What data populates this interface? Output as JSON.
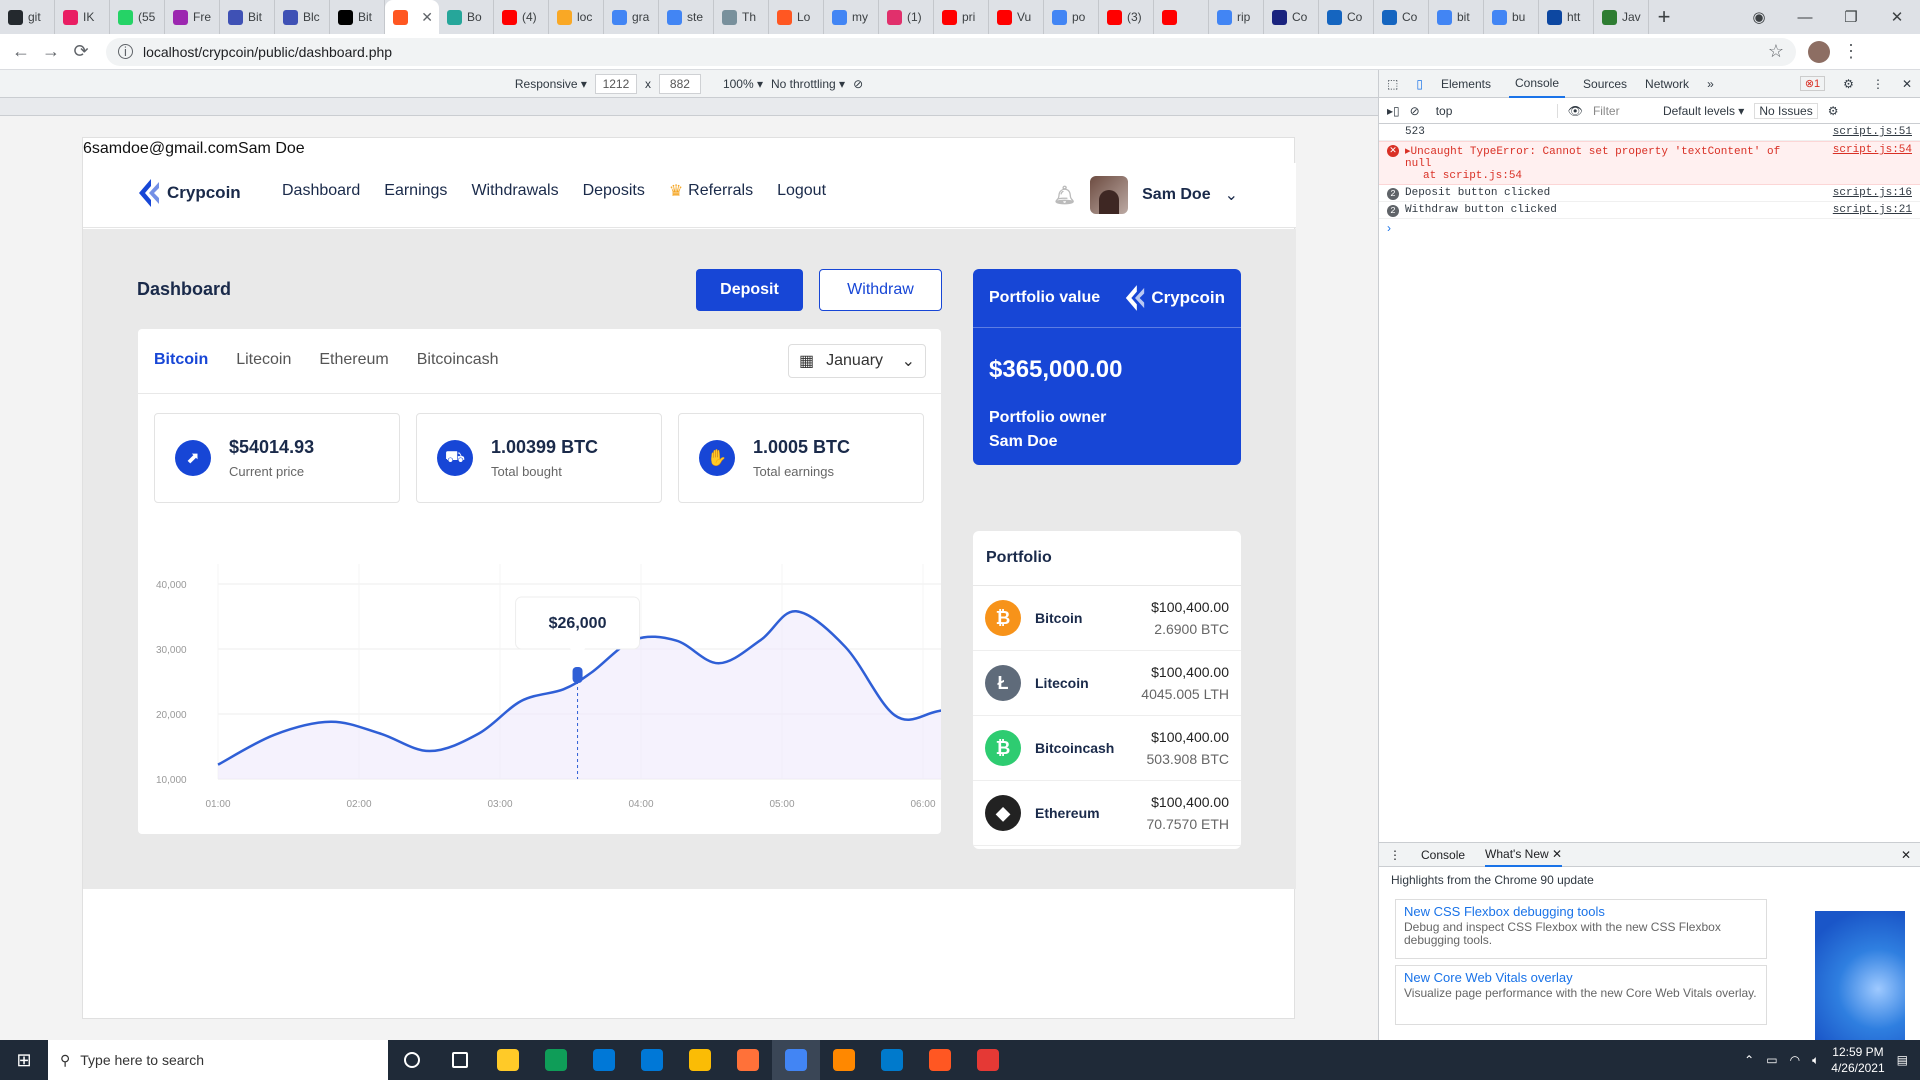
{
  "browser": {
    "tabs": [
      {
        "label": "git",
        "color": "#24292e"
      },
      {
        "label": "IK",
        "color": "#e91e63"
      },
      {
        "label": "(55",
        "color": "#25d366"
      },
      {
        "label": "Fre",
        "color": "#9c27b0"
      },
      {
        "label": "Bit",
        "color": "#3f51b5"
      },
      {
        "label": "Blc",
        "color": "#3f51b5"
      },
      {
        "label": "Bit",
        "color": "#000000"
      },
      {
        "label": "",
        "color": "#ff5722",
        "active": true
      },
      {
        "label": "Bo",
        "color": "#26a69a"
      },
      {
        "label": "(4)",
        "color": "#ff0000"
      },
      {
        "label": "loc",
        "color": "#f9a825"
      },
      {
        "label": "gra",
        "color": "#4285f4"
      },
      {
        "label": "ste",
        "color": "#4285f4"
      },
      {
        "label": "Th",
        "color": "#78909c"
      },
      {
        "label": "Lo",
        "color": "#ff5722"
      },
      {
        "label": "my",
        "color": "#4285f4"
      },
      {
        "label": "(1)",
        "color": "#e1306c"
      },
      {
        "label": "pri",
        "color": "#ff0000"
      },
      {
        "label": "Vu",
        "color": "#ff0000"
      },
      {
        "label": "po",
        "color": "#4285f4"
      },
      {
        "label": "(3)",
        "color": "#ff0000"
      },
      {
        "label": "",
        "color": "#ff0000"
      },
      {
        "label": "rip",
        "color": "#4285f4"
      },
      {
        "label": "Co",
        "color": "#1a237e"
      },
      {
        "label": "Co",
        "color": "#1565c0"
      },
      {
        "label": "Co",
        "color": "#1565c0"
      },
      {
        "label": "bit",
        "color": "#4285f4"
      },
      {
        "label": "bu",
        "color": "#4285f4"
      },
      {
        "label": "htt",
        "color": "#0d47a1"
      },
      {
        "label": "Jav",
        "color": "#2e7d32"
      }
    ],
    "close_glyph": "✕",
    "new_tab": "+",
    "url": "localhost/crypcoin/public/dashboard.php"
  },
  "devbar": {
    "mode": "Responsive ▾",
    "width": "1212",
    "times": "x",
    "height": "882",
    "zoom": "100% ▾",
    "throttle": "No throttling ▾"
  },
  "page": {
    "topline": "6samdoe@gmail.comSam Doe",
    "brand": "Crypcoin",
    "nav": [
      "Dashboard",
      "Earnings",
      "Withdrawals",
      "Deposits",
      "Referrals",
      "Logout"
    ],
    "user_name": "Sam Doe",
    "dashboard_title": "Dashboard",
    "deposit_label": "Deposit",
    "withdraw_label": "Withdraw",
    "coin_tabs": [
      "Bitcoin",
      "Litecoin",
      "Ethereum",
      "Bitcoincash"
    ],
    "month": "January",
    "stats": [
      {
        "value": "$54014.93",
        "label": "Current price"
      },
      {
        "value": "1.00399 BTC",
        "label": "Total bought"
      },
      {
        "value": "1.0005 BTC",
        "label": "Total earnings"
      }
    ],
    "portfolio_value_label": "Portfolio value",
    "portfolio_value": "$365,000.00",
    "portfolio_owner_label": "Portfolio owner",
    "portfolio_owner": "Sam Doe",
    "portfolio_title": "Portfolio",
    "portfolio": [
      {
        "name": "Bitcoin",
        "amount": "$100,400.00",
        "qty": "2.6900 BTC",
        "symbol": "₿",
        "color": "#f7931a"
      },
      {
        "name": "Litecoin",
        "amount": "$100,400.00",
        "qty": "4045.005 LTH",
        "symbol": "Ł",
        "color": "#5f6b7a"
      },
      {
        "name": "Bitcoincash",
        "amount": "$100,400.00",
        "qty": "503.908 BTC",
        "symbol": "₿",
        "color": "#2ecc71"
      },
      {
        "name": "Ethereum",
        "amount": "$100,400.00",
        "qty": "70.7570 ETH",
        "symbol": "◆",
        "color": "#222222"
      }
    ]
  },
  "chart_data": {
    "type": "line",
    "x": [
      "01:00",
      "02:00",
      "03:00",
      "04:00",
      "05:00",
      "06:00"
    ],
    "yticks": [
      "10,000",
      "20,000",
      "30,000",
      "40,000"
    ],
    "ylim": [
      10000,
      40000
    ],
    "points": [
      {
        "t": 0.0,
        "v": 12200
      },
      {
        "t": 0.4,
        "v": 16800
      },
      {
        "t": 0.8,
        "v": 18800
      },
      {
        "t": 1.15,
        "v": 17000
      },
      {
        "t": 1.5,
        "v": 14300
      },
      {
        "t": 1.85,
        "v": 17000
      },
      {
        "t": 2.15,
        "v": 22000
      },
      {
        "t": 2.45,
        "v": 23800
      },
      {
        "t": 2.65,
        "v": 26400
      },
      {
        "t": 2.95,
        "v": 31400
      },
      {
        "t": 3.25,
        "v": 31300
      },
      {
        "t": 3.55,
        "v": 27800
      },
      {
        "t": 3.85,
        "v": 31400
      },
      {
        "t": 4.1,
        "v": 35800
      },
      {
        "t": 4.45,
        "v": 30300
      },
      {
        "t": 4.8,
        "v": 19800
      },
      {
        "t": 5.1,
        "v": 20400
      },
      {
        "t": 5.45,
        "v": 22600
      }
    ],
    "highlight": {
      "t": 2.55,
      "v": 26000,
      "label": "$26,000"
    },
    "grid": true,
    "color": "#2f5fd6"
  },
  "devtools": {
    "tabs": [
      "Elements",
      "Console",
      "Sources",
      "Network",
      "»"
    ],
    "error_count": "⊗1",
    "context": "top",
    "filter_placeholder": "Filter",
    "levels": "Default levels ▾",
    "issues": "No Issues",
    "logs": [
      {
        "text": "523",
        "src": "script.js:51",
        "kind": "log"
      },
      {
        "text": "▸Uncaught TypeError: Cannot set property 'textContent' of null",
        "sub": "at script.js:54",
        "src": "script.js:54",
        "kind": "error"
      },
      {
        "text": "Deposit button clicked",
        "src": "script.js:16",
        "kind": "info",
        "count": "2"
      },
      {
        "text": "Withdraw button clicked",
        "src": "script.js:21",
        "kind": "info",
        "count": "2"
      }
    ],
    "drawer_tabs": [
      "Console",
      "What's New ✕"
    ],
    "highlights": "Highlights from the Chrome 90 update",
    "cards": [
      {
        "title": "New CSS Flexbox debugging tools",
        "desc": "Debug and inspect CSS Flexbox with the new CSS Flexbox debugging tools."
      },
      {
        "title": "New Core Web Vitals overlay",
        "desc": "Visualize page performance with the new Core Web Vitals overlay."
      }
    ]
  },
  "taskbar": {
    "search_placeholder": "Type here to search",
    "time": "12:59 PM",
    "date": "4/26/2021",
    "apps": [
      "#ffffff",
      "#ffffff",
      "#ffca28",
      "#0f9d58",
      "#0078d7",
      "#0078d7",
      "#fbbc05",
      "#ff7139",
      "#4285f4",
      "#ff8800",
      "#007acc",
      "#ff5722",
      "#e53935"
    ]
  }
}
